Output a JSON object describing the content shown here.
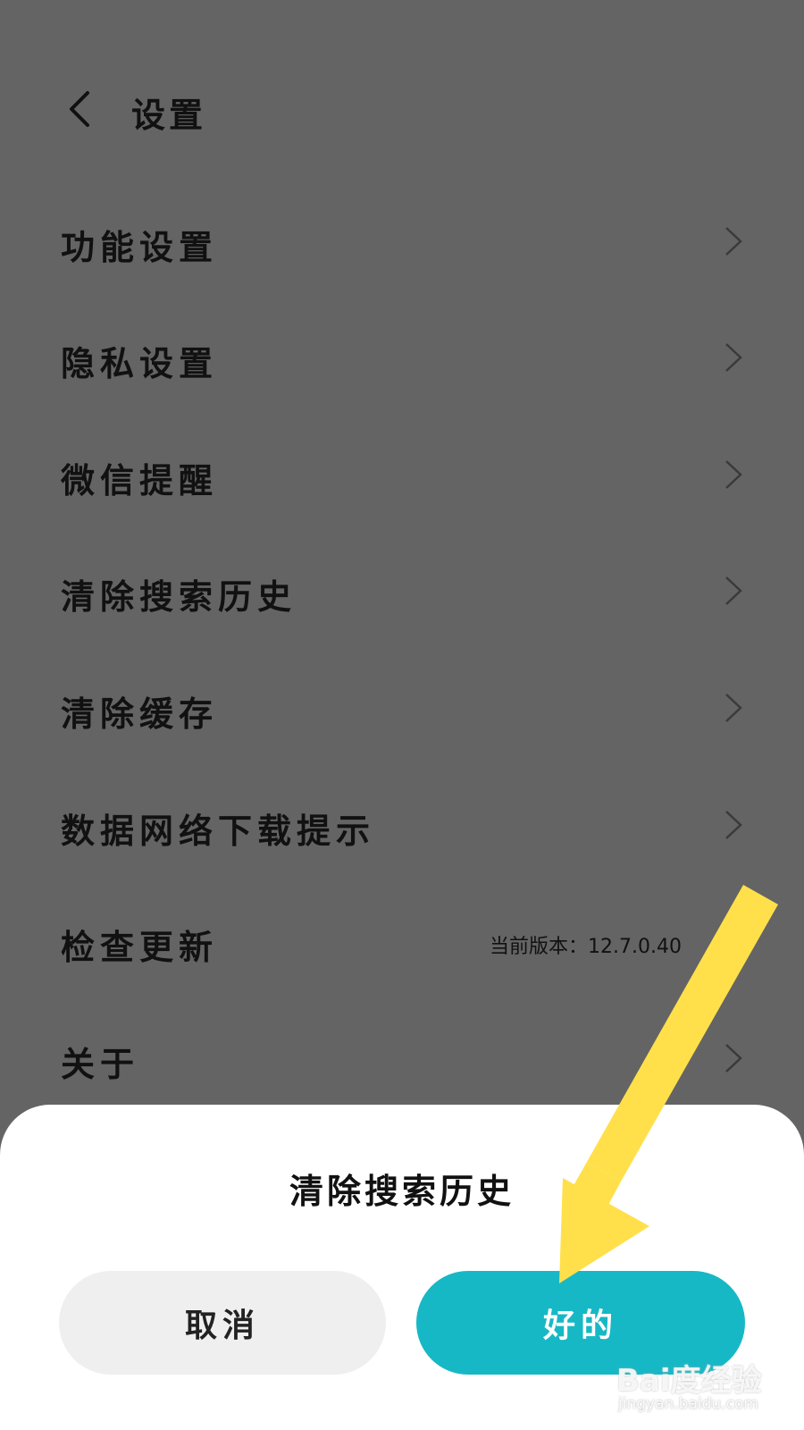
{
  "header": {
    "back_icon": "chevron-left-icon",
    "title": "设置"
  },
  "menu": {
    "items": [
      {
        "label": "功能设置",
        "icon": "chevron-right-icon"
      },
      {
        "label": "隐私设置",
        "icon": "chevron-right-icon"
      },
      {
        "label": "微信提醒",
        "icon": "chevron-right-icon"
      },
      {
        "label": "清除搜索历史",
        "icon": "chevron-right-icon"
      },
      {
        "label": "清除缓存",
        "icon": "chevron-right-icon"
      },
      {
        "label": "数据网络下载提示",
        "icon": "chevron-right-icon"
      },
      {
        "label": "检查更新",
        "version": "当前版本：12.7.0.40"
      },
      {
        "label": "关于",
        "icon": "chevron-right-icon"
      }
    ]
  },
  "dialog": {
    "title": "清除搜索历史",
    "cancel_label": "取消",
    "ok_label": "好的"
  },
  "colors": {
    "background": "#646464",
    "accent": "#17b8c6",
    "annotation_arrow": "#ffe04a"
  },
  "watermark": {
    "brand": "Bai度经验",
    "url": "jingyan.baidu.com"
  }
}
